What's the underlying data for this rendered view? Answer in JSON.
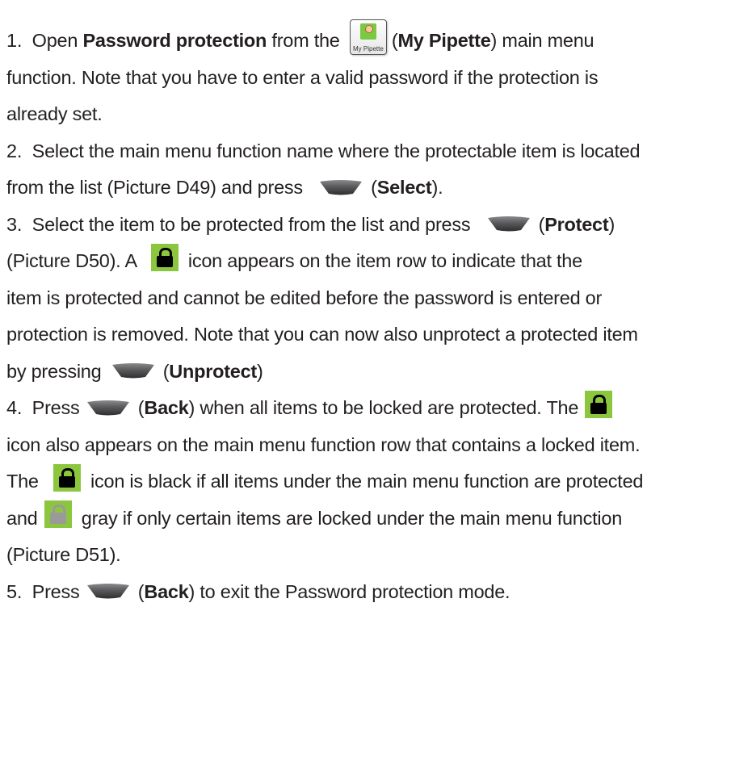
{
  "steps": [
    {
      "number": "1.",
      "lines": [
        [
          "Open ",
          "Password protection",
          " from the ",
          "(",
          "My Pipette",
          ") main menu"
        ],
        [
          "function. Note that you have to enter a valid password if the protection is"
        ],
        [
          "already set."
        ]
      ]
    },
    {
      "number": "2.",
      "lines": [
        [
          "Select the main menu function name where the protectable item is located"
        ],
        [
          "from the list (Picture D49) and press ",
          "(",
          "Select",
          ")."
        ]
      ]
    },
    {
      "number": "3.",
      "lines": [
        [
          "Select the item to be protected from the list and press ",
          "(",
          "Protect",
          ")"
        ],
        [
          "(Picture D50). A ",
          "icon appears on the item row to indicate that the"
        ],
        [
          "item is protected and cannot be edited before the password is entered or"
        ],
        [
          "protection is removed. Note that you can now also unprotect a protected item"
        ],
        [
          "by pressing ",
          "(",
          "Unprotect",
          ")"
        ]
      ]
    },
    {
      "number": "4.",
      "lines": [
        [
          "Press ",
          "(",
          "Back",
          ") when all items to be locked are protected. The "
        ],
        [
          "icon also appears on the main menu function row that contains a locked item."
        ],
        [
          "The ",
          "icon is black if all items under the main menu function are protected"
        ],
        [
          "and ",
          "gray if only certain items are locked under the main menu function"
        ],
        [
          "(Picture D51)."
        ]
      ]
    },
    {
      "number": "5.",
      "lines": [
        [
          "Press ",
          "(",
          "Back",
          ") to exit the Password protection mode."
        ]
      ]
    }
  ],
  "icons": {
    "my_pipette_caption": "My Pipette",
    "softkey_color": "#4d4d4f",
    "lock_bg_color": "#8cc63f",
    "lock_black": "#000000",
    "lock_gray": "#9a9a9a"
  }
}
